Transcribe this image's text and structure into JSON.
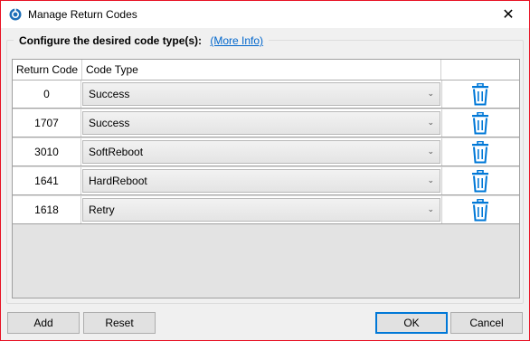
{
  "window": {
    "title": "Manage Return Codes",
    "close_glyph": "✕",
    "accent_border": "#e81123"
  },
  "group": {
    "label": "Configure the desired code type(s):",
    "more_info": "(More Info)"
  },
  "grid": {
    "columns": [
      "Return Code",
      "Code Type"
    ],
    "rows": [
      {
        "code": "0",
        "type": "Success"
      },
      {
        "code": "1707",
        "type": "Success"
      },
      {
        "code": "3010",
        "type": "SoftReboot"
      },
      {
        "code": "1641",
        "type": "HardReboot"
      },
      {
        "code": "1618",
        "type": "Retry"
      }
    ],
    "dropdown_glyph": "⌄",
    "delete_icon": "trash-icon",
    "delete_icon_color": "#0078d7"
  },
  "buttons": {
    "add": "Add",
    "reset": "Reset",
    "ok": "OK",
    "cancel": "Cancel"
  }
}
